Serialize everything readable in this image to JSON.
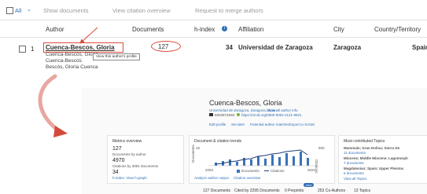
{
  "toolbar": {
    "all_label": "All",
    "show_documents": "Show documents",
    "view_citation_overview": "View citation overview",
    "request_merge": "Request to merge authors"
  },
  "table": {
    "headers": [
      "Author",
      "Documents",
      "h-index",
      "Affiliation",
      "City",
      "Country/Territory"
    ],
    "row": {
      "index": "1",
      "name": "Cuenca-Bescos, Gloria",
      "variants": [
        "Cuenca-Bescós, Gloria",
        "Cuenca-Bescós",
        "Bescós, Gloria Cuenca"
      ],
      "documents": "127",
      "h_index": "34",
      "affiliation": "Universidad de Zaragoza",
      "city": "Zaragoza",
      "country": "Spain",
      "tooltip": "View this author's profile"
    }
  },
  "profile": {
    "name": "Cuenca-Bescos, Gloria",
    "affiliation_line": "Universidad de Zaragoza, Zaragoza, Spain",
    "show_all_info": "Show all author info",
    "id_line": "6603574838",
    "orcid": "https://orcid.org/0000-0002-1121-9621",
    "actions": [
      "Edit profile",
      "Set alert",
      "Potential author matches",
      "Export to SciVal"
    ],
    "metrics": {
      "title": "Metrics overview",
      "docs_value": "127",
      "docs_label": "Documents by author",
      "citations_value": "4970",
      "citations_label": "Citations by 3991 documents",
      "hindex_value": "34",
      "hindex_label": "h-index: View h-graph"
    },
    "trends": {
      "title": "Document & citation trends",
      "ylabel_left": "Documents",
      "ylabel_right": "Citations",
      "left_tick": "15",
      "right_tick": "600",
      "x_start": "2003",
      "x_end": "2022",
      "legend": [
        "Documents",
        "Citations"
      ],
      "link": "Analyze author output",
      "link2": "Citation overview"
    },
    "topics": {
      "title": "Most contributed Topics",
      "items": [
        {
          "label": "Mammals; Gran Dolina; Sierra De",
          "docs": "11 documents"
        },
        {
          "label": "Miocene; Middle Miocene; Lagomorph",
          "docs": "7 documents"
        },
        {
          "label": "Magdalenian; Spain; Upper Pleistoc",
          "docs": "5 documents"
        }
      ],
      "link": "View all Topics"
    },
    "tabs": {
      "documents": "127 Documents",
      "cited_by": "Cited by 2295 Documents",
      "preprints": "0 Preprints",
      "coauthors": "253 Co-Authors",
      "topics": "13 Topics",
      "badge": "new"
    }
  },
  "colors": {
    "accent": "#2e6fb5",
    "arrow": "#d44a3a",
    "highlight": "#e04a3a",
    "bars": "#3a72b8"
  }
}
